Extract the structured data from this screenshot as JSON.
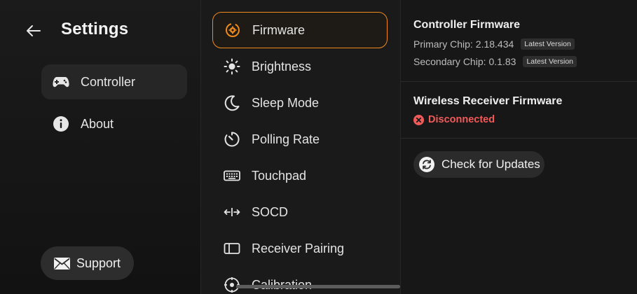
{
  "header": {
    "title": "Settings"
  },
  "sidebar": {
    "items": [
      {
        "label": "Controller",
        "icon": "gamepad-icon",
        "active": true
      },
      {
        "label": "About",
        "icon": "info-icon",
        "active": false
      }
    ],
    "support_label": "Support"
  },
  "menu": {
    "items": [
      {
        "label": "Firmware",
        "icon": "firmware-icon",
        "active": true
      },
      {
        "label": "Brightness",
        "icon": "brightness-icon"
      },
      {
        "label": "Sleep Mode",
        "icon": "moon-icon"
      },
      {
        "label": "Polling Rate",
        "icon": "timer-icon"
      },
      {
        "label": "Touchpad",
        "icon": "keyboard-icon"
      },
      {
        "label": "SOCD",
        "icon": "arrows-icon"
      },
      {
        "label": "Receiver Pairing",
        "icon": "receiver-icon"
      },
      {
        "label": "Calibration",
        "icon": "crosshair-icon"
      }
    ]
  },
  "firmware": {
    "controller": {
      "title": "Controller Firmware",
      "primary_label": "Primary Chip:",
      "primary_version": "2.18.434",
      "primary_badge": "Latest Version",
      "secondary_label": "Secondary Chip:",
      "secondary_version": "0.1.83",
      "secondary_badge": "Latest Version"
    },
    "receiver": {
      "title": "Wireless Receiver Firmware",
      "status": "Disconnected"
    },
    "check_updates_label": "Check for Updates"
  },
  "colors": {
    "accent": "#f08a1c",
    "error": "#f25a5a",
    "background": "#161616"
  }
}
